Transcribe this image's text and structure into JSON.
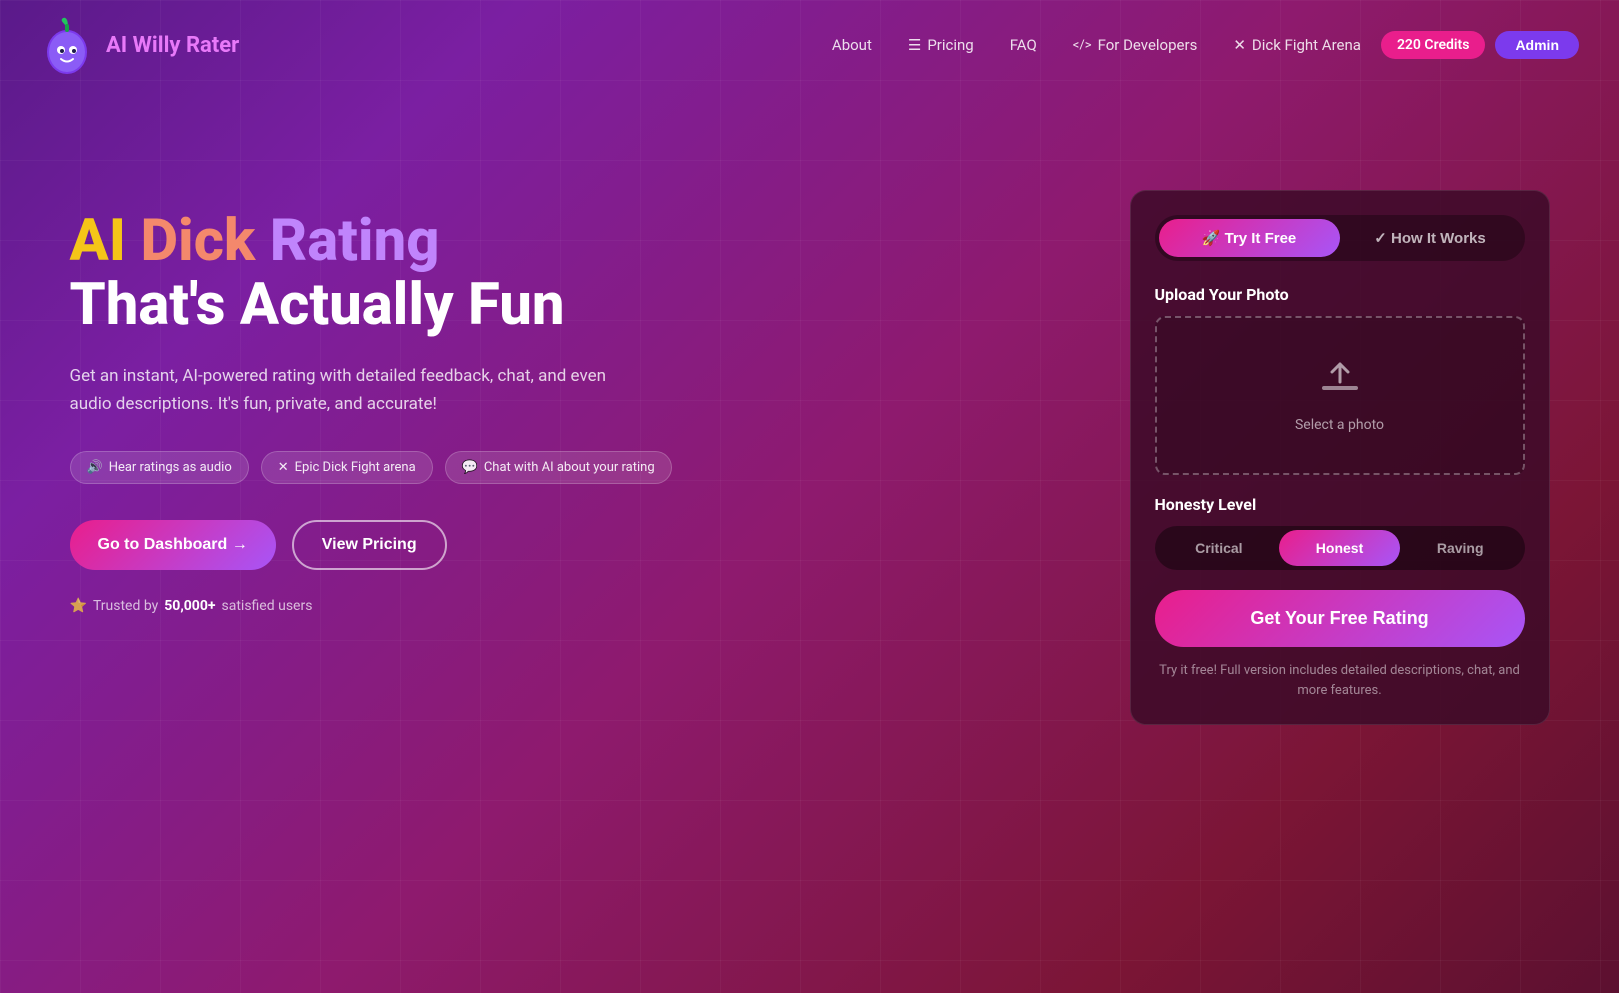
{
  "nav": {
    "logo_text": "AI Willy Rater",
    "links": [
      {
        "label": "About",
        "icon": ""
      },
      {
        "label": "Pricing",
        "icon": "☰"
      },
      {
        "label": "FAQ",
        "icon": ""
      },
      {
        "label": "For Developers",
        "icon": "</>"
      },
      {
        "label": "Dick Fight Arena",
        "icon": "✕"
      }
    ],
    "credits_label": "220 Credits",
    "admin_label": "Admin"
  },
  "hero": {
    "title_ai": "AI",
    "title_dick": "Dick",
    "title_rating": "Rating",
    "title_line2": "That's Actually Fun",
    "description": "Get an instant, AI-powered rating with detailed feedback, chat, and even audio descriptions. It's fun, private, and accurate!",
    "features": [
      {
        "icon": "🔊",
        "label": "Hear ratings as audio"
      },
      {
        "icon": "✕",
        "label": "Epic Dick Fight arena"
      },
      {
        "icon": "💬",
        "label": "Chat with AI about your rating"
      }
    ],
    "btn_dashboard": "Go to Dashboard →",
    "btn_pricing": "View Pricing",
    "trust_text": "Trusted by",
    "trust_count": "50,000+",
    "trust_suffix": "satisfied users"
  },
  "card": {
    "tab_try": "🚀 Try It Free",
    "tab_how": "✓ How It Works",
    "upload_label": "Upload Your Photo",
    "upload_text": "Select a photo",
    "honesty_label": "Honesty Level",
    "honesty_options": [
      {
        "label": "Critical",
        "active": false
      },
      {
        "label": "Honest",
        "active": true
      },
      {
        "label": "Raving",
        "active": false
      }
    ],
    "btn_get_rating": "Get Your Free Rating",
    "footer_text": "Try it free! Full version includes detailed descriptions, chat, and more features."
  }
}
